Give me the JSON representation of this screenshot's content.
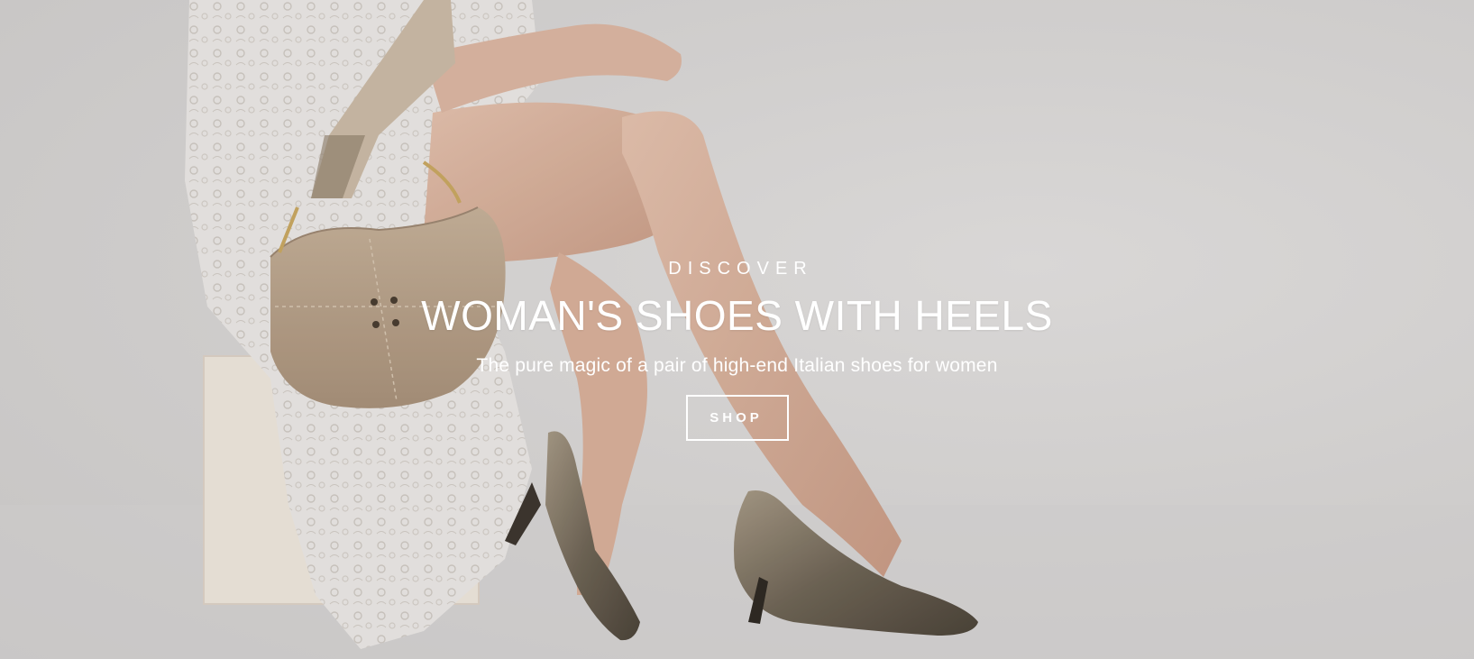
{
  "hero": {
    "eyebrow": "DISCOVER",
    "title": "WOMAN'S SHOES WITH HEELS",
    "subtitle": "The pure magic of a pair of high-end Italian shoes for women",
    "cta_label": "SHOP"
  },
  "colors": {
    "background": "#dad8d7",
    "text": "#ffffff",
    "bag": "#b9a48a",
    "dress": "#e9e6e3",
    "shoe": "#7b7061",
    "skin": "#d9b4a0"
  }
}
